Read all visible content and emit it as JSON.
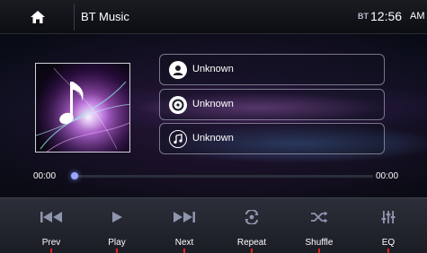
{
  "header": {
    "title": "BT Music",
    "bt_badge": "BT",
    "time": "12:56",
    "ampm": "AM",
    "home_icon": "home-icon"
  },
  "track_info": [
    {
      "icon": "artist-icon",
      "value": "Unknown"
    },
    {
      "icon": "album-disc-icon",
      "value": "Unknown"
    },
    {
      "icon": "music-note-icon",
      "value": "Unknown"
    }
  ],
  "progress": {
    "elapsed": "00:00",
    "total": "00:00",
    "fraction": 0
  },
  "controls": [
    {
      "label": "Prev",
      "icon": "previous-icon"
    },
    {
      "label": "Play",
      "icon": "play-icon"
    },
    {
      "label": "Next",
      "icon": "next-icon"
    },
    {
      "label": "Repeat",
      "icon": "repeat-icon"
    },
    {
      "label": "Shuffle",
      "icon": "shuffle-icon"
    },
    {
      "label": "EQ",
      "icon": "equalizer-icon"
    }
  ],
  "colors": {
    "accent_tick": "#e0241b",
    "progress_thumb": "#9aa6ff",
    "control_icon": "#8e95ad"
  }
}
